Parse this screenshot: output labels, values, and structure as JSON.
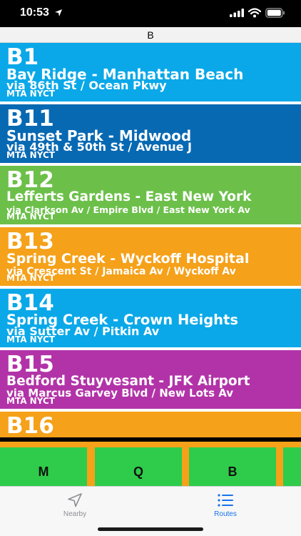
{
  "status_bar": {
    "time": "10:53"
  },
  "section_header": "B",
  "routes": [
    {
      "number": "B1",
      "name": "Bay Ridge - Manhattan Beach",
      "via": "via 86th St / Ocean Pkwy",
      "agency": "MTA NYCT",
      "color": "#0aa8e8"
    },
    {
      "number": "B11",
      "name": "Sunset Park - Midwood",
      "via": "via 49th & 50th St / Avenue J",
      "agency": "MTA NYCT",
      "color": "#0869b3"
    },
    {
      "number": "B12",
      "name": "Lefferts Gardens - East New York",
      "via": "via Clarkson Av / Empire Blvd / East New York Av",
      "agency": "MTA NYCT",
      "color": "#6cc04a"
    },
    {
      "number": "B13",
      "name": "Spring Creek - Wyckoff Hospital",
      "via": "via Crescent St / Jamaica Av / Wyckoff Av",
      "agency": "MTA NYCT",
      "color": "#f5a11a"
    },
    {
      "number": "B14",
      "name": "Spring Creek - Crown Heights",
      "via": "via Sutter Av / Pitkin Av",
      "agency": "MTA NYCT",
      "color": "#0aa8e8"
    },
    {
      "number": "B15",
      "name": "Bedford Stuyvesant - JFK Airport",
      "via": "via Marcus Garvey Blvd / New Lots Av",
      "agency": "MTA NYCT",
      "color": "#b233a8"
    },
    {
      "number": "B16",
      "name": "",
      "via": "",
      "agency": "",
      "color": "#f5a11a"
    }
  ],
  "index_bar": {
    "letters": [
      "M",
      "Q",
      "B"
    ]
  },
  "tab_bar": {
    "tabs": [
      {
        "label": "Nearby",
        "icon": "navigation-arrow-icon",
        "active": false
      },
      {
        "label": "Routes",
        "icon": "list-icon",
        "active": true
      }
    ],
    "active_color": "#1a73e8",
    "inactive_color": "#8e8e93"
  }
}
